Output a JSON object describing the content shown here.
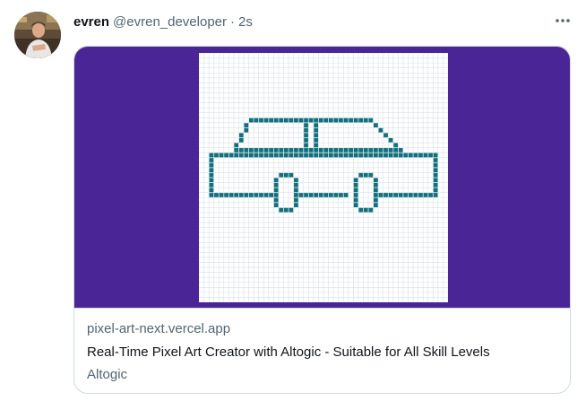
{
  "author": {
    "name": "evren",
    "handle": "@evren_developer",
    "separator": "·",
    "time": "2s",
    "avatar_icon": "user-avatar"
  },
  "menu": {
    "icon": "more-horizontal-icon"
  },
  "card": {
    "domain": "pixel-art-next.vercel.app",
    "title": "Real-Time Pixel Art Creator with Altogic - Suitable for All Skill Levels",
    "site": "Altogic",
    "media_background": "#4a2596",
    "pixel_color": "#11707e",
    "canvas_background": "#ffffff",
    "grid_color": "#d9e0e6",
    "pixel_art_subject": "car"
  }
}
